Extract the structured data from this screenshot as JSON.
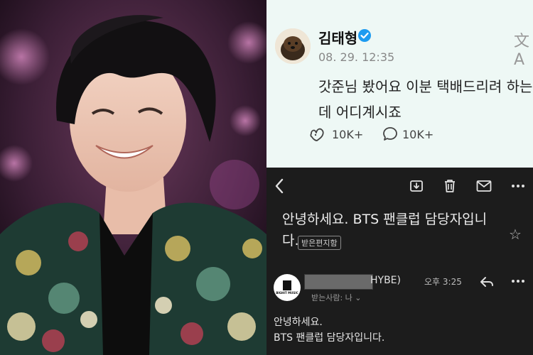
{
  "post": {
    "username": "김태형",
    "timestamp": "08. 29. 12:35",
    "text_lines": [
      "갓준님 봤어요 이분 택배드리려 하는",
      "데 어디계시죠"
    ],
    "likes": "10K+",
    "comments": "10K+",
    "translate_glyph": "文A"
  },
  "mail": {
    "subject_lines": [
      "안녕하세요. BTS 팬클럽 담당자입니",
      "다."
    ],
    "folder_badge": "받은편지함",
    "sender_suffix": "HYBE)",
    "sent_time": "오후 3:25",
    "recipient": "받는사람: 나 ⌄",
    "logo_text": "BIGHIT MUSIC",
    "body_lines": [
      "안녕하세요.",
      "BTS 팬클럽 담당자입니다."
    ],
    "star_glyph": "☆"
  },
  "colors": {
    "post_bg": "#eef8f5",
    "verified_blue": "#1d9bf0",
    "mail_bg": "#1c1c1c"
  },
  "icons": [
    "verified-badge-icon",
    "translate-icon",
    "like-icon",
    "comment-icon",
    "back-icon",
    "archive-icon",
    "trash-icon",
    "mail-icon",
    "more-icon",
    "star-icon",
    "reply-icon"
  ]
}
